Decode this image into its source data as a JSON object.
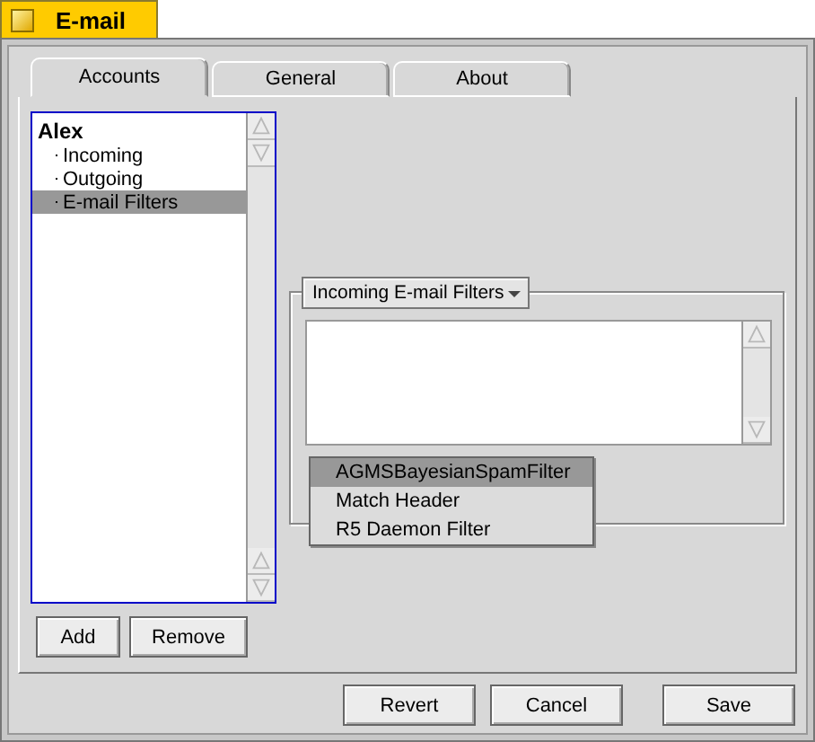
{
  "window": {
    "title": "E-mail"
  },
  "tabs": [
    {
      "label": "Accounts",
      "selected": true
    },
    {
      "label": "General",
      "selected": false
    },
    {
      "label": "About",
      "selected": false
    }
  ],
  "accounts": [
    {
      "label": "Alex",
      "kind": "account",
      "selected": false
    },
    {
      "label": "Incoming",
      "kind": "sub",
      "selected": false
    },
    {
      "label": "Outgoing",
      "kind": "sub",
      "selected": false
    },
    {
      "label": "E-mail Filters",
      "kind": "sub",
      "selected": true
    }
  ],
  "list_buttons": [
    "Add",
    "Remove"
  ],
  "filters": {
    "menu_label": "Incoming E-mail Filters",
    "menu": [
      {
        "label": "AGMSBayesianSpamFilter",
        "selected": true
      },
      {
        "label": "Match Header",
        "selected": false
      },
      {
        "label": "R5 Daemon Filter",
        "selected": false
      }
    ]
  },
  "buttons": [
    "Revert",
    "Cancel",
    "Save"
  ]
}
